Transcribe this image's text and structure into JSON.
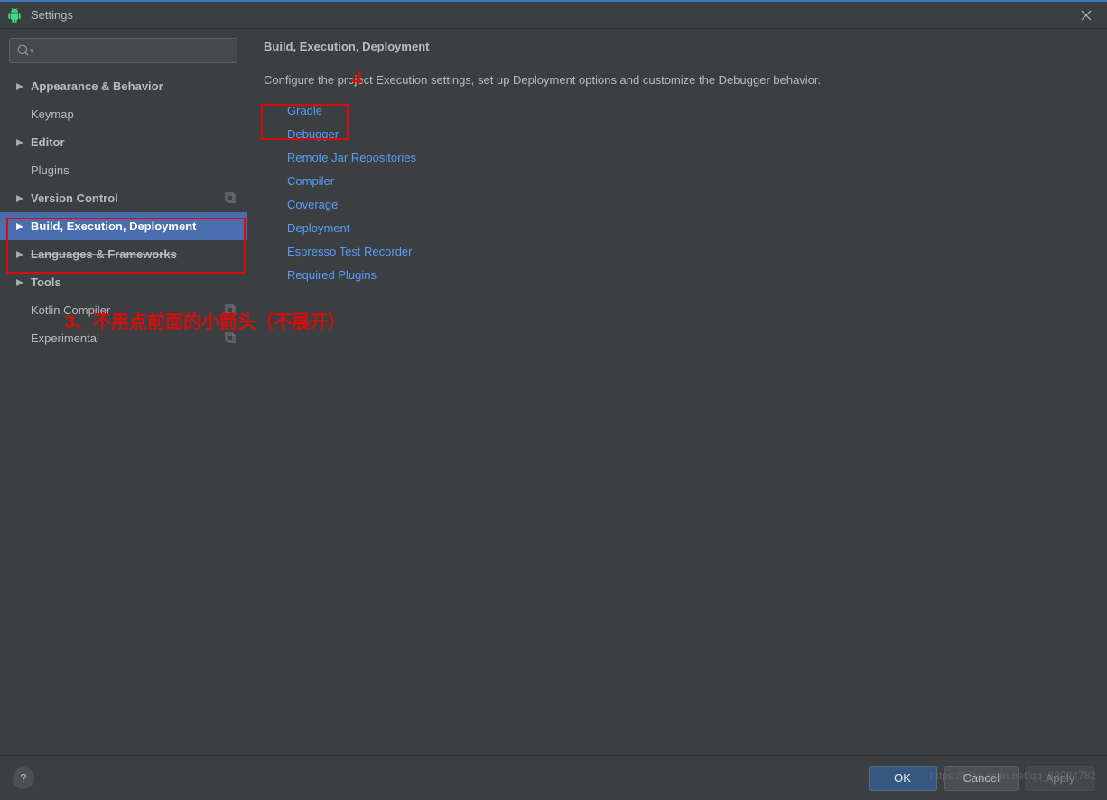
{
  "window": {
    "title": "Settings",
    "close_tooltip": "Close"
  },
  "sidebar": {
    "search_placeholder": "",
    "items": [
      {
        "label": "Appearance & Behavior",
        "expandable": true,
        "child": false,
        "bold": true
      },
      {
        "label": "Keymap",
        "expandable": false,
        "child": true,
        "bold": false
      },
      {
        "label": "Editor",
        "expandable": true,
        "child": false,
        "bold": true
      },
      {
        "label": "Plugins",
        "expandable": false,
        "child": true,
        "bold": false
      },
      {
        "label": "Version Control",
        "expandable": true,
        "child": false,
        "bold": true,
        "copyable": true
      },
      {
        "label": "Build, Execution, Deployment",
        "expandable": true,
        "child": false,
        "bold": true,
        "selected": true
      },
      {
        "label": "Languages & Frameworks",
        "expandable": true,
        "child": false,
        "bold": true,
        "struck": true
      },
      {
        "label": "Tools",
        "expandable": true,
        "child": false,
        "bold": true
      },
      {
        "label": "Kotlin Compiler",
        "expandable": false,
        "child": true,
        "bold": false,
        "copyable": true
      },
      {
        "label": "Experimental",
        "expandable": false,
        "child": true,
        "bold": false,
        "copyable": true
      }
    ]
  },
  "content": {
    "title": "Build, Execution, Deployment",
    "description": "Configure the project Execution settings, set up Deployment options and customize the Debugger behavior.",
    "links": [
      "Gradle",
      "Debugger",
      "Remote Jar Repositories",
      "Compiler",
      "Coverage",
      "Deployment",
      "Espresso Test Recorder",
      "Required Plugins"
    ]
  },
  "footer": {
    "help": "?",
    "ok": "OK",
    "cancel": "Cancel",
    "apply": "Apply"
  },
  "annotations": {
    "num": "4",
    "text": "3、不用点前面的小箭头（不展开）"
  },
  "watermark": "https://blog.csdn.net/qq_38924782"
}
